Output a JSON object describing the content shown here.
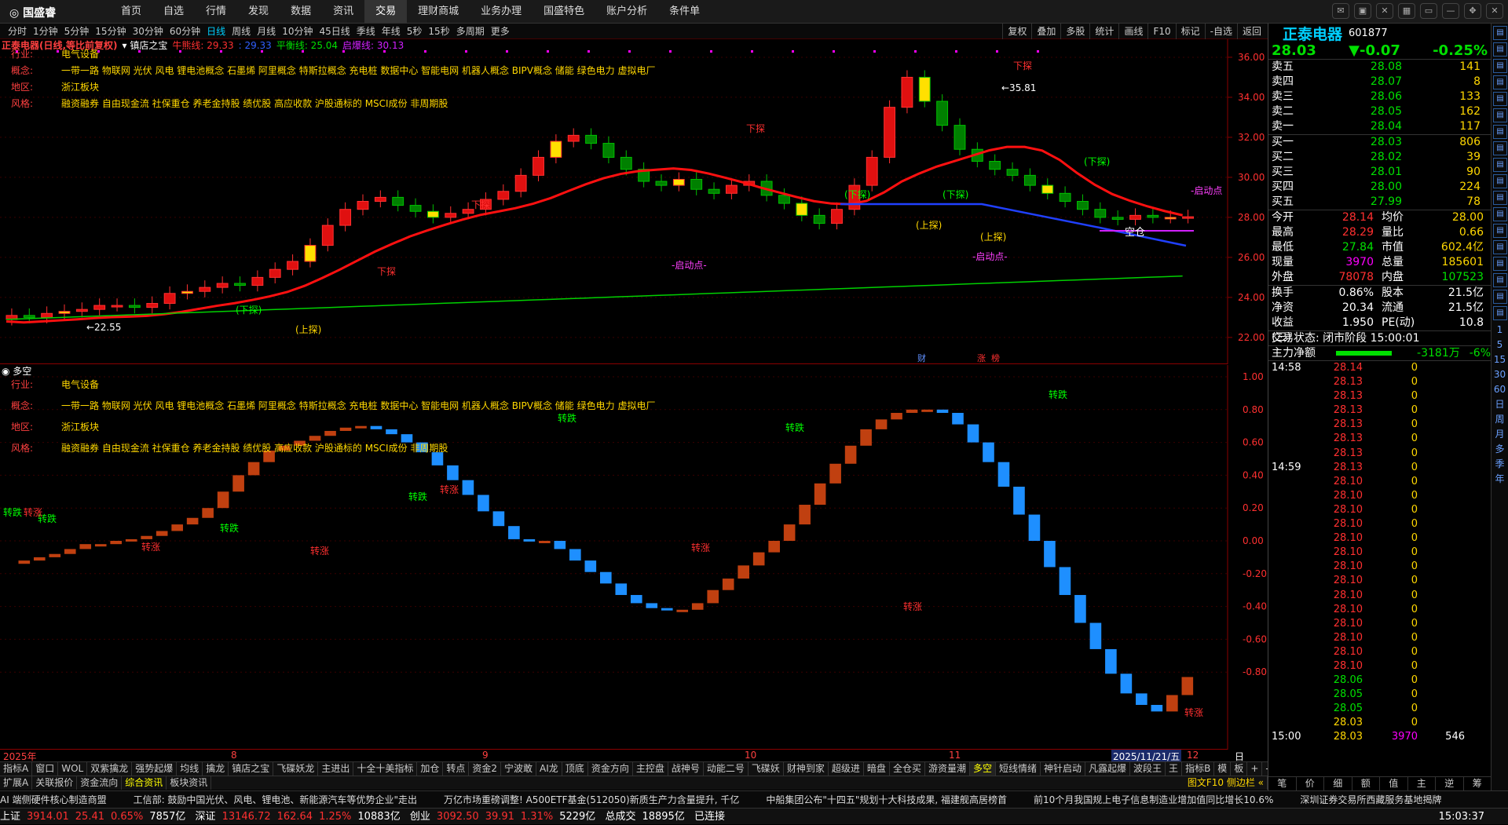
{
  "app": {
    "logo": "国盛睿",
    "nav": [
      "首页",
      "自选",
      "行情",
      "发现",
      "数据",
      "资讯",
      "交易",
      "理财商城",
      "业务办理",
      "国盛特色",
      "账户分析",
      "条件单"
    ],
    "nav_active": 6
  },
  "periods": [
    "分时",
    "1分钟",
    "5分钟",
    "15分钟",
    "30分钟",
    "60分钟",
    "日线",
    "周线",
    "月线",
    "10分钟",
    "45日线",
    "季线",
    "年线",
    "5秒",
    "15秒",
    "多周期",
    "更多"
  ],
  "period_active": 6,
  "tools": [
    "复权",
    "叠加",
    "多股",
    "统计",
    "画线",
    "F10",
    "标记",
    "-自选",
    "返回"
  ],
  "main_header": {
    "name": "正泰电器(日线,等比前复权)",
    "ind": "镇店之宝",
    "l1": "牛熊线: 29.33",
    "l2": ": 29.33",
    "l3": "平衡线: 25.04",
    "l4": "启爆线: 30.13"
  },
  "info": {
    "rows": [
      [
        "行业:",
        "电气设备"
      ],
      [
        "概念:",
        "一带一路 物联网 光伏 风电 锂电池概念 石墨烯 阿里概念 特斯拉概念 充电桩 数据中心 智能电网 机器人概念 BIPV概念 储能 绿色电力 虚拟电厂"
      ],
      [
        "地区:",
        "浙江板块"
      ],
      [
        "风格:",
        "融资融券 自由现金流 社保重仓 养老金持股 绩优股 高应收款 沪股通标的 MSCI成份 非周期股"
      ]
    ]
  },
  "top_axis": [
    "36.00",
    "34.00",
    "32.00",
    "30.00",
    "28.00",
    "26.00",
    "24.00",
    "22.00"
  ],
  "top_labels": {
    "low": "22.55",
    "high": "35.81",
    "xia1": "下探",
    "xia2": "(下探)",
    "shang": "(上探)",
    "qidong": "-启动点-",
    "qidong_right": "启动点",
    "kongcang": "空仓",
    "fin": "财",
    "zhang": "涨",
    "yao": "榜"
  },
  "bot_header": "多空",
  "bot_axis": [
    "1.00",
    "0.80",
    "0.60",
    "0.40",
    "0.20",
    "0.00",
    "-0.20",
    "-0.40",
    "-0.60",
    "-0.80"
  ],
  "bot_labels": {
    "zd": "转跌",
    "zz": "转涨"
  },
  "xaxis": {
    "start": "2025年",
    "m8": "8",
    "m9": "9",
    "m10": "10",
    "m11": "11",
    "date": "2025/11/21/五",
    "m12": "12",
    "right": "日线"
  },
  "tabs1": [
    "指标A",
    "窗口",
    "WOL",
    "双紫擒龙",
    "强势起爆",
    "均线",
    "擒龙",
    "镇店之宝",
    "飞碟妖龙",
    "主进出",
    "十全十美指标",
    "加仓",
    "转点",
    "资金2",
    "宁波敢",
    "AI龙",
    "顶底",
    "资金方向",
    "主控盘",
    "战神号",
    "动能二号",
    "飞碟妖",
    "财神到家",
    "超级进",
    "暗盘",
    "全仓买",
    "游资量潮",
    "多空",
    "短线情绪",
    "神针启动",
    "凡露起爆",
    "波段王",
    "王"
  ],
  "tabs1_right": [
    "指标B",
    "模",
    "板",
    "+",
    "-"
  ],
  "tabs2": [
    "扩展A",
    "关联报价",
    "资金流向",
    "综合资讯",
    "板块资讯"
  ],
  "tabs2_right": "图文F10 侧边栏 «",
  "news": [
    "AI 端侧硬件核心制造商盟",
    "工信部: 鼓励中国光伏、风电、锂电池、新能源汽车等优势企业\"走出",
    "万亿市场重磅调整! A500ETF基金(512050)新质生产力含量提升, 千亿",
    "中船集团公布\"十四五\"规划十大科技成果, 福建舰高居榜首",
    "前10个月我国规上电子信息制造业增加值同比增长10.6%",
    "深圳证券交易所西藏服务基地揭牌"
  ],
  "status": {
    "sh_lbl": "上证",
    "sh": "3914.01",
    "sh_ch": "25.41",
    "sh_p": "0.65%",
    "sh_v": "7857亿",
    "sz_lbl": "深证",
    "sz": "13146.72",
    "sz_ch": "162.64",
    "sz_p": "1.25%",
    "sz_v": "10883亿",
    "cy_lbl": "创业",
    "cy": "3092.50",
    "cy_ch": "39.91",
    "cy_p": "1.31%",
    "cy_v": "5229亿",
    "tot_lbl": "总成交",
    "tot": "18895亿",
    "conn": "已连接",
    "time": "15:03:37"
  },
  "quote": {
    "name": "正泰电器",
    "code": "601877",
    "price": "28.03",
    "chg": "▼-0.07",
    "pct": "-0.25%",
    "sell": [
      [
        "卖五",
        "28.08",
        "141"
      ],
      [
        "卖四",
        "28.07",
        "8"
      ],
      [
        "卖三",
        "28.06",
        "133"
      ],
      [
        "卖二",
        "28.05",
        "162"
      ],
      [
        "卖一",
        "28.04",
        "117"
      ]
    ],
    "buy": [
      [
        "买一",
        "28.03",
        "806"
      ],
      [
        "买二",
        "28.02",
        "39"
      ],
      [
        "买三",
        "28.01",
        "90"
      ],
      [
        "买四",
        "28.00",
        "224"
      ],
      [
        "买五",
        "27.99",
        "78"
      ]
    ],
    "stats": [
      [
        "今开",
        "28.14",
        "均价",
        "28.00"
      ],
      [
        "最高",
        "28.29",
        "量比",
        "0.66"
      ],
      [
        "最低",
        "27.84",
        "市值",
        "602.4亿"
      ],
      [
        "现量",
        "3970",
        "总量",
        "185601"
      ],
      [
        "外盘",
        "78078",
        "内盘",
        "107523"
      ]
    ],
    "stats2": [
      [
        "换手",
        "0.86%",
        "股本",
        "21.5亿"
      ],
      [
        "净资",
        "20.34",
        "流通",
        "21.5亿"
      ],
      [
        "收益(三)",
        "1.950",
        "PE(动)",
        "10.8"
      ]
    ],
    "trade_state": "交易状态: 闭市阶段 15:00:01",
    "net_lbl": "主力净额",
    "net": "-3181万",
    "net_pct": "-6%",
    "ticks": [
      [
        "14:58",
        "28.14",
        "0"
      ],
      [
        "",
        "28.13",
        "0"
      ],
      [
        "",
        "28.13",
        "0"
      ],
      [
        "",
        "28.13",
        "0"
      ],
      [
        "",
        "28.13",
        "0"
      ],
      [
        "",
        "28.13",
        "0"
      ],
      [
        "",
        "28.13",
        "0"
      ],
      [
        "14:59",
        "28.13",
        "0"
      ],
      [
        "",
        "28.10",
        "0"
      ],
      [
        "",
        "28.10",
        "0"
      ],
      [
        "",
        "28.10",
        "0"
      ],
      [
        "",
        "28.10",
        "0"
      ],
      [
        "",
        "28.10",
        "0"
      ],
      [
        "",
        "28.10",
        "0"
      ],
      [
        "",
        "28.10",
        "0"
      ],
      [
        "",
        "28.10",
        "0"
      ],
      [
        "",
        "28.10",
        "0"
      ],
      [
        "",
        "28.10",
        "0"
      ],
      [
        "",
        "28.10",
        "0"
      ],
      [
        "",
        "28.10",
        "0"
      ],
      [
        "",
        "28.10",
        "0"
      ],
      [
        "",
        "28.10",
        "0"
      ],
      [
        "",
        "28.06",
        "0"
      ],
      [
        "",
        "28.05",
        "0"
      ],
      [
        "",
        "28.05",
        "0"
      ],
      [
        "",
        "28.03",
        "0"
      ],
      [
        "15:00",
        "28.03",
        "3970"
      ]
    ],
    "tick_last_extra": "546",
    "tabs": [
      "笔",
      "价",
      "细",
      "额",
      "值",
      "主",
      "逆",
      "筹"
    ]
  },
  "strip": [
    "1",
    "5",
    "15",
    "30",
    "60",
    "日",
    "周",
    "月",
    "多",
    "季",
    "年"
  ],
  "chart_data": {
    "type": "candlestick",
    "bot_series": [
      -0.14,
      -0.12,
      -0.1,
      -0.08,
      -0.05,
      -0.02,
      -0.02,
      0.0,
      0.01,
      0.03,
      0.06,
      0.1,
      0.14,
      0.2,
      0.3,
      0.4,
      0.48,
      0.55,
      0.58,
      0.61,
      0.64,
      0.67,
      0.69,
      0.7,
      0.68,
      0.65,
      0.6,
      0.54,
      0.46,
      0.37,
      0.28,
      0.18,
      0.09,
      0.01,
      0.0,
      0.0,
      -0.05,
      -0.12,
      -0.19,
      -0.26,
      -0.33,
      -0.38,
      -0.41,
      -0.42,
      -0.42,
      -0.38,
      -0.3,
      -0.23,
      -0.15,
      -0.07,
      0.0,
      0.1,
      0.22,
      0.35,
      0.47,
      0.58,
      0.68,
      0.74,
      0.78,
      0.8,
      0.8,
      0.78,
      0.71,
      0.6,
      0.48,
      0.33,
      0.16,
      0.0,
      -0.16,
      -0.33,
      -0.5,
      -0.66,
      -0.81,
      -0.93,
      -1.0,
      -1.04,
      -0.94,
      -0.83
    ],
    "top_close": [
      23.1,
      23.0,
      23.2,
      23.3,
      23.4,
      23.6,
      23.6,
      23.5,
      23.7,
      24.2,
      24.3,
      24.5,
      24.7,
      24.6,
      25.0,
      25.4,
      25.8,
      26.6,
      27.6,
      28.4,
      28.8,
      29.0,
      28.6,
      28.3,
      28.0,
      28.2,
      28.4,
      28.9,
      29.3,
      30.1,
      31.0,
      31.8,
      32.1,
      31.7,
      31.0,
      30.4,
      29.8,
      29.6,
      29.9,
      29.4,
      29.2,
      29.6,
      29.8,
      29.1,
      28.7,
      28.1,
      27.7,
      28.4,
      29.6,
      31.0,
      33.5,
      35.0,
      33.8,
      32.6,
      31.4,
      30.8,
      30.4,
      30.1,
      29.6,
      29.2,
      28.8,
      28.4,
      28.0,
      27.9,
      28.1,
      28.0,
      28.0,
      28.03
    ]
  }
}
